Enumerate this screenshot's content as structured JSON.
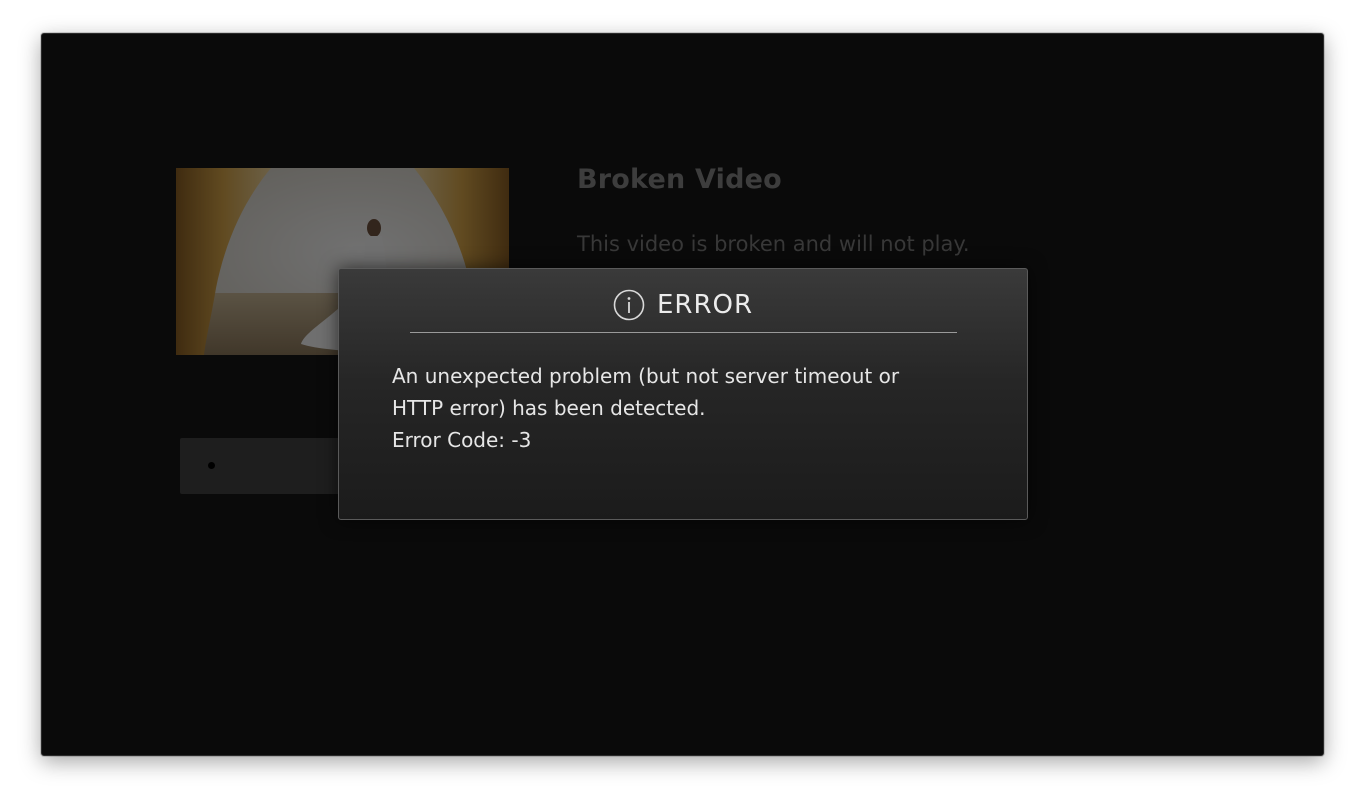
{
  "details": {
    "title": "Broken Video",
    "description": "This video is broken and will not play."
  },
  "thumbnail": {
    "icon": "video-thumbnail-image"
  },
  "error_dialog": {
    "icon": "info-icon",
    "title": "ERROR",
    "message_line1": "An unexpected problem (but not server timeout or",
    "message_line2": "HTTP error) has been detected.",
    "error_code": "Error Code: -3"
  },
  "colors": {
    "background": "#0a0a0a",
    "dialog_top": "#3a3a3a",
    "dialog_bottom": "#1b1b1b",
    "dialog_text": "#e6e6e6"
  }
}
